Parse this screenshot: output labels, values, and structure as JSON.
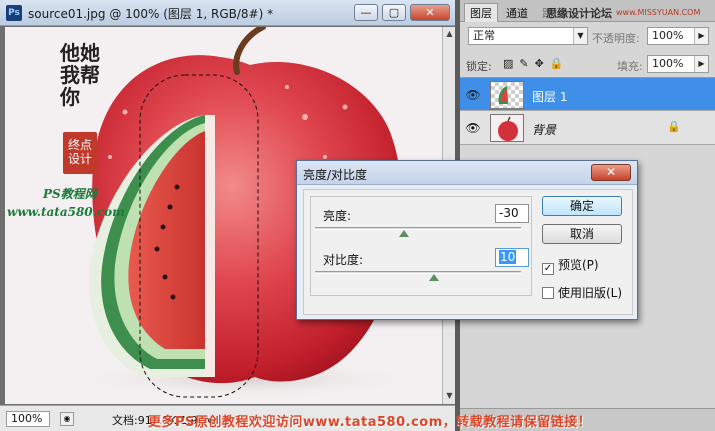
{
  "document": {
    "ps_icon": "Ps",
    "title": "source01.jpg @ 100% (图层 1, RGB/8#) *",
    "window_buttons": [
      "—",
      "▢",
      "✕"
    ],
    "zoom": "100%",
    "doc_info": "文档:918.8K/1.97M"
  },
  "panel": {
    "tabs": [
      "图层",
      "通道",
      "路径"
    ],
    "tab_overlay_text": "思缘设计论坛",
    "tab_overlay_site": "www.MISSYUAN.COM",
    "blend_mode": "正常",
    "opacity_label": "不透明度:",
    "opacity_value": "100%",
    "lock_label": "锁定:",
    "fill_label": "填充:",
    "fill_value": "100%",
    "layers": [
      {
        "name": "图层 1",
        "selected": true
      },
      {
        "name": "背景",
        "selected": false
      }
    ]
  },
  "dialog": {
    "title": "亮度/对比度",
    "close": "✕",
    "brightness_label": "亮度:",
    "brightness_value": "-30",
    "contrast_label": "对比度:",
    "contrast_value": "10",
    "ok_label": "确定",
    "cancel_label": "取消",
    "preview_label": "预览(P)",
    "preview_checked": true,
    "legacy_label": "使用旧版(L)",
    "legacy_checked": false
  },
  "watermarks": {
    "vertical": "他她我帮你",
    "seal": "终点设计",
    "psnet": "PS教程网",
    "url": "www.tata580.com",
    "bottom_banner": "更多PS原创教程欢迎访问www.tata580.com，转载教程请保留链接！"
  }
}
